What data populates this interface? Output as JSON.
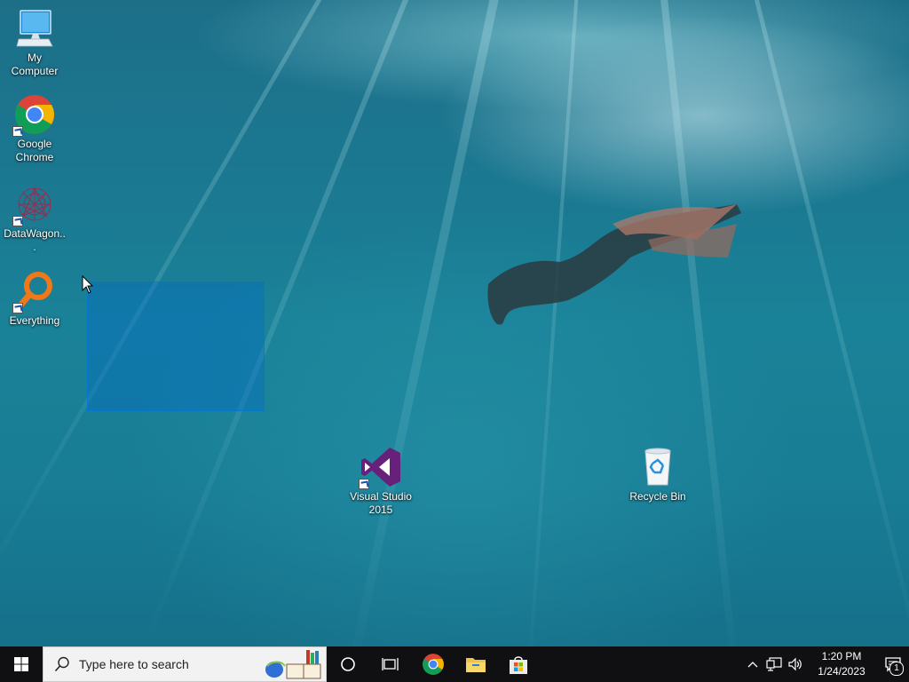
{
  "desktop": {
    "icons": [
      {
        "id": "my-computer",
        "label": "My Computer"
      },
      {
        "id": "google-chrome",
        "label": "Google Chrome"
      },
      {
        "id": "datawagon",
        "label": "DataWagon..."
      },
      {
        "id": "everything",
        "label": "Everything"
      },
      {
        "id": "visual-studio",
        "label": "Visual Studio 2015"
      },
      {
        "id": "recycle-bin",
        "label": "Recycle Bin"
      }
    ]
  },
  "taskbar": {
    "search_placeholder": "Type here to search",
    "pinned": [
      "cortana-icon",
      "task-view-icon",
      "chrome-icon",
      "file-explorer-icon",
      "microsoft-store-icon"
    ],
    "clock": {
      "time": "1:20 PM",
      "date": "1/24/2023"
    },
    "notification_count": "1"
  },
  "colors": {
    "taskbar": "#101012",
    "selection": "#0066cc",
    "vs_purple": "#68217a"
  }
}
